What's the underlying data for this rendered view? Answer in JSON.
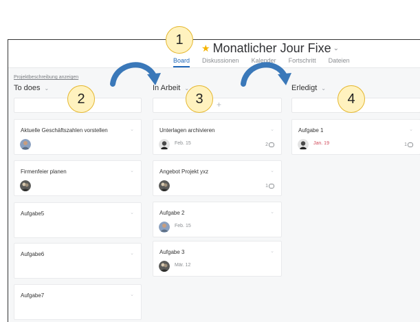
{
  "header": {
    "title": "Monatlicher Jour Fixe",
    "tabs": [
      {
        "label": "Board"
      },
      {
        "label": "Diskussionen"
      },
      {
        "label": "Kalender"
      },
      {
        "label": "Fortschritt"
      },
      {
        "label": "Dateien"
      }
    ]
  },
  "project_link": "Projektbeschreibung anzeigen",
  "columns": {
    "todo": {
      "title": "To does",
      "cards": [
        {
          "title": "Aktuelle Geschäftszahlen vorstellen"
        },
        {
          "title": "Firmenfeier planen"
        },
        {
          "title": "Aufgabe5"
        },
        {
          "title": "Aufgabe6"
        },
        {
          "title": "Aufgabe7"
        }
      ]
    },
    "in_progress": {
      "title": "In Arbeit",
      "add_icon": "+",
      "cards": [
        {
          "title": "Unterlagen archivieren",
          "date": "Feb. 15",
          "comments": "2"
        },
        {
          "title": "Angebot Projekt yxz",
          "comments": "1"
        },
        {
          "title": "Aufgabe 2",
          "date": "Feb. 15"
        },
        {
          "title": "Aufgabe 3",
          "date": "Mär. 12"
        }
      ]
    },
    "done": {
      "title": "Erledigt",
      "cards": [
        {
          "title": "Aufgabe 1",
          "date": "Jan. 19",
          "comments": "1"
        }
      ]
    }
  },
  "badges": [
    "1",
    "2",
    "3",
    "4"
  ],
  "icons": {
    "star": "star-icon",
    "chevron": "chevron-down-icon",
    "comment": "comment-icon",
    "plus": "plus-icon",
    "arrow": "curved-arrow-icon"
  },
  "colors": {
    "accent": "#1f67b8",
    "star": "#f6b400",
    "overdue": "#d04a5a",
    "badge_fill": "#fff2bf",
    "badge_border": "#e4b62d",
    "arrow": "#3a78b9"
  }
}
